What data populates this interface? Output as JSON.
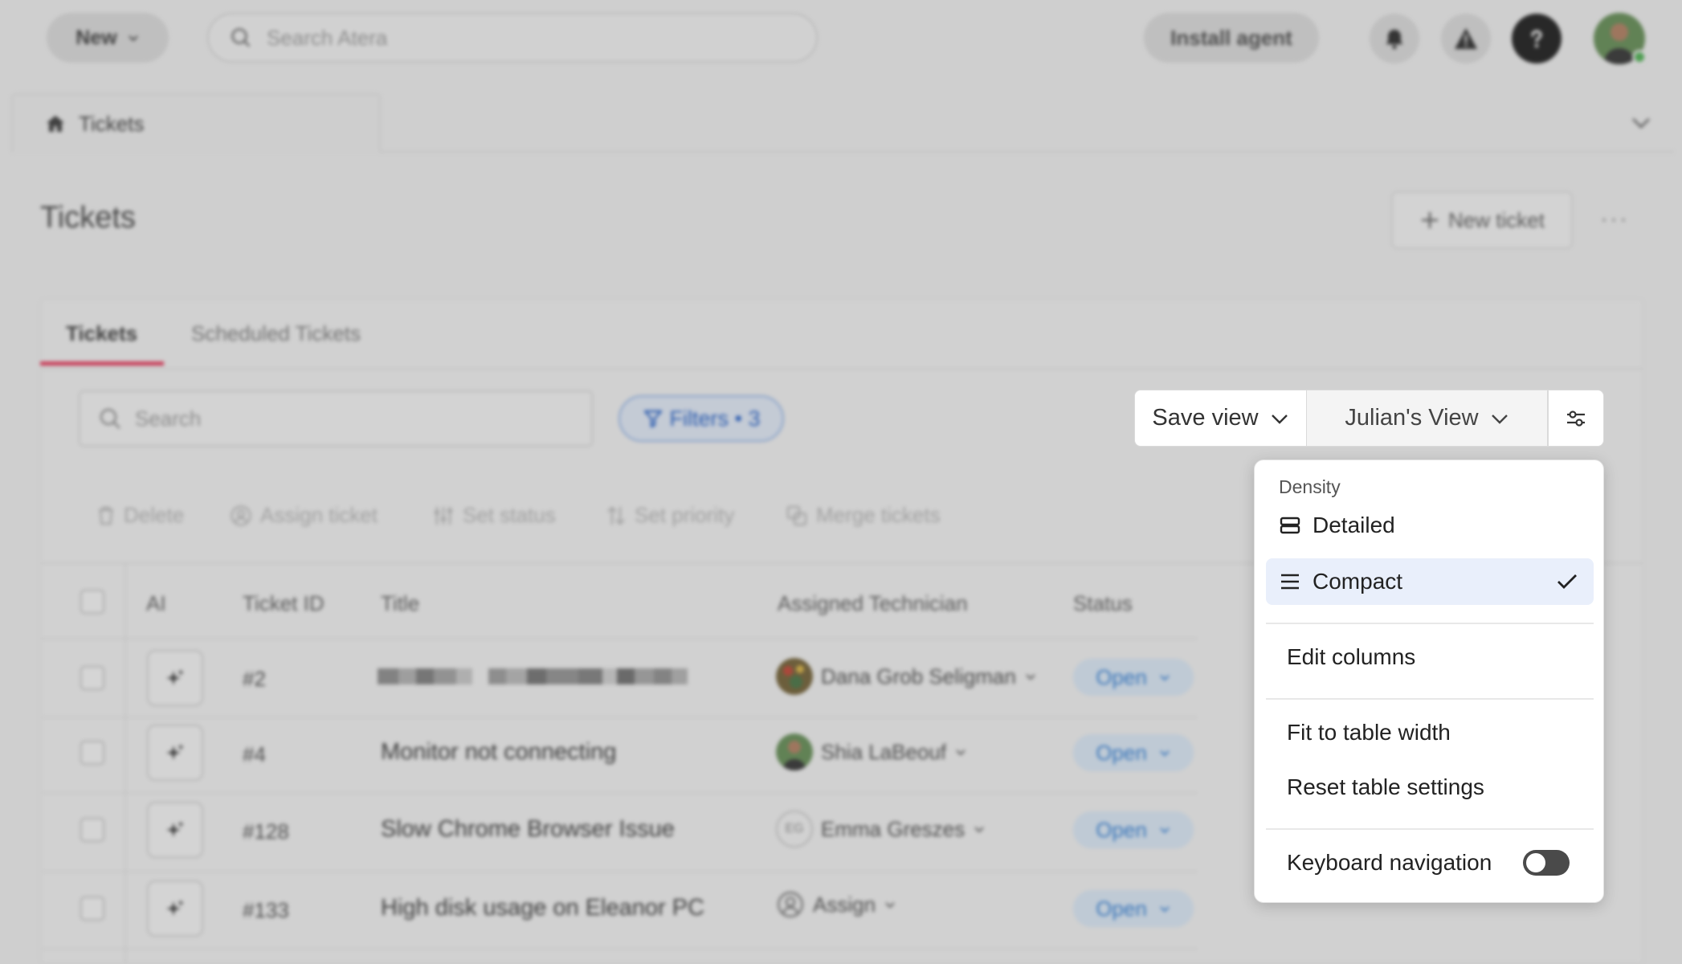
{
  "topbar": {
    "new_label": "New",
    "search_placeholder": "Search Atera",
    "install_label": "Install agent"
  },
  "page_tab": {
    "label": "Tickets"
  },
  "page": {
    "title": "Tickets",
    "new_ticket_label": "New ticket"
  },
  "tabs": [
    {
      "label": "Tickets",
      "active": true
    },
    {
      "label": "Scheduled Tickets",
      "active": false
    }
  ],
  "list": {
    "search_placeholder": "Search",
    "filters_label": "Filters • 3"
  },
  "bulk_actions": [
    "Delete",
    "Assign ticket",
    "Set status",
    "Set priority",
    "Merge tickets"
  ],
  "table": {
    "headers": [
      "AI",
      "Ticket ID",
      "Title",
      "Assigned Technician",
      "Status"
    ],
    "rows": [
      {
        "id": "#2",
        "title": "",
        "technician": "Dana Grob Seligman",
        "status": "Open",
        "title_redacted": true
      },
      {
        "id": "#4",
        "title": "Monitor not connecting",
        "technician": "Shia LaBeouf",
        "status": "Open"
      },
      {
        "id": "#128",
        "title": "Slow Chrome Browser Issue",
        "technician": "Emma Greszes",
        "tech_initials": "EG",
        "status": "Open"
      },
      {
        "id": "#133",
        "title": "High disk usage on Eleanor PC",
        "technician": "Assign",
        "status": "Open"
      }
    ]
  },
  "views": {
    "save_view_label": "Save view",
    "current_view_label": "Julian's View"
  },
  "table_settings_menu": {
    "density_heading": "Density",
    "density_options": [
      {
        "label": "Detailed",
        "selected": false
      },
      {
        "label": "Compact",
        "selected": true
      }
    ],
    "edit_columns_label": "Edit columns",
    "fit_label": "Fit to table width",
    "reset_label": "Reset table settings",
    "keyboard_nav_label": "Keyboard navigation",
    "keyboard_nav_enabled": false
  },
  "colors": {
    "accent_tab": "#e8294f",
    "filter_blue": "#1a5ac8",
    "status_blue": "#2c7cd6",
    "selected_bg": "#e9effb"
  }
}
